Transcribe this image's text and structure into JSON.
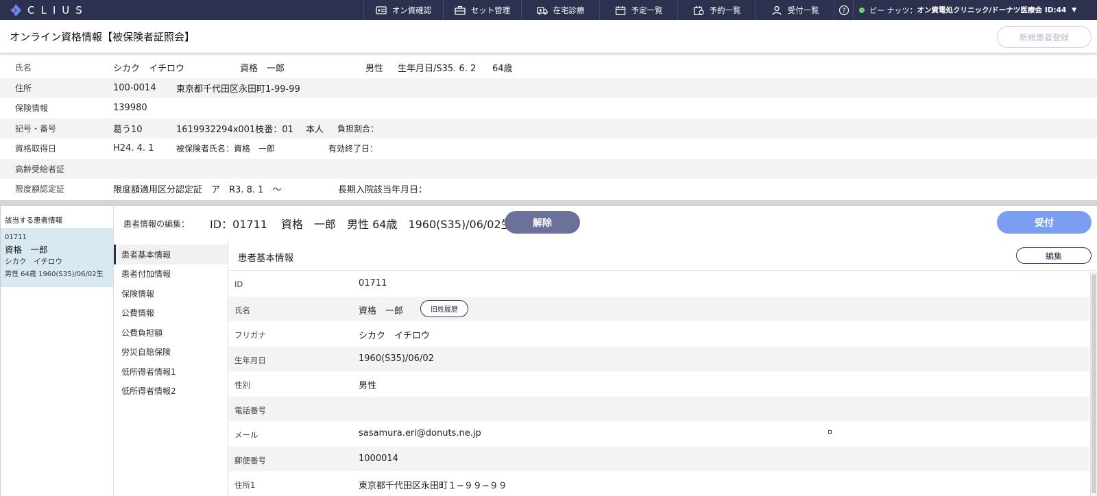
{
  "nav": {
    "logo_text": "CLIUS",
    "items": [
      {
        "label": "オン資確認",
        "icon": "id-card-icon"
      },
      {
        "label": "セット管理",
        "icon": "briefcase-icon"
      },
      {
        "label": "在宅診療",
        "icon": "ambulance-icon"
      },
      {
        "label": "予定一覧",
        "icon": "calendar-icon"
      },
      {
        "label": "予約一覧",
        "icon": "calendar-clock-icon"
      },
      {
        "label": "受付一覧",
        "icon": "user-icon"
      }
    ],
    "help": "?",
    "user_name": "ピー ナッツ：",
    "clinic": "オン資電処クリニック/ドーナツ医療会",
    "user_id": "ID:44",
    "caret": "▼",
    "status_color": "#6ed36a"
  },
  "header": {
    "title": "オンライン資格情報【被保険者証照会】",
    "new_button": "新規患者登録"
  },
  "info": {
    "name_label": "氏名",
    "name_kana": "シカク　イチロウ",
    "name_kanji": "資格　一郎",
    "gender": "男性",
    "birth": "生年月日/S35. 6. 2",
    "age": "64歳",
    "address_label": "住所",
    "zip": "100-0014",
    "address": "東京都千代田区永田町1-99-99",
    "insurance_label": "保険情報",
    "insurance_no": "139980",
    "symbol_label": "記号・番号",
    "symbol": "葛う10",
    "number": "1619932294x001枝番：01",
    "relation": "本人",
    "burden": "負担割合：",
    "acquired_label": "資格取得日",
    "acquired": "H24. 4. 1",
    "insured_name": "被保険者氏名：資格　一郎",
    "valid_end": "有効終了日：",
    "elderly_label": "高齢受給者証",
    "limit_label": "限度額認定証",
    "limit_value": "限度額適用区分認定証　ア　R3. 8. 1　～",
    "long_term": "長期入院該当年月日："
  },
  "left_panel": {
    "title": "該当する患者情報",
    "patient": {
      "id": "01711",
      "name": "資格　一郎",
      "kana": "シカク　イチロウ",
      "info": "男性 64歳 1960(S35)/06/02生"
    }
  },
  "edit": {
    "label": "患者情報の編集：",
    "id": "ID：01711",
    "info": "資格　一郎　男性 64歳　1960(S35)/06/02生",
    "release_button": "解除",
    "accept_button": "受付"
  },
  "sub_nav": [
    "患者基本情報",
    "患者付加情報",
    "保険情報",
    "公費情報",
    "公費負担額",
    "労災自賠保険",
    "低所得者情報1",
    "低所得者情報2"
  ],
  "detail": {
    "title": "患者基本情報",
    "edit_button": "編集",
    "history_button": "旧姓履歴",
    "rows": [
      {
        "label": "ID",
        "value": "01711"
      },
      {
        "label": "氏名",
        "value": "資格　一郎"
      },
      {
        "label": "フリガナ",
        "value": "シカク　イチロウ"
      },
      {
        "label": "生年月日",
        "value": "1960(S35)/06/02"
      },
      {
        "label": "性別",
        "value": "男性"
      },
      {
        "label": "電話番号",
        "value": ""
      },
      {
        "label": "メール",
        "value": "sasamura.eri@donuts.ne.jp"
      },
      {
        "label": "郵便番号",
        "value": "1000014"
      },
      {
        "label": "住所1",
        "value": "東京都千代田区永田町１−９９−９９"
      }
    ]
  }
}
